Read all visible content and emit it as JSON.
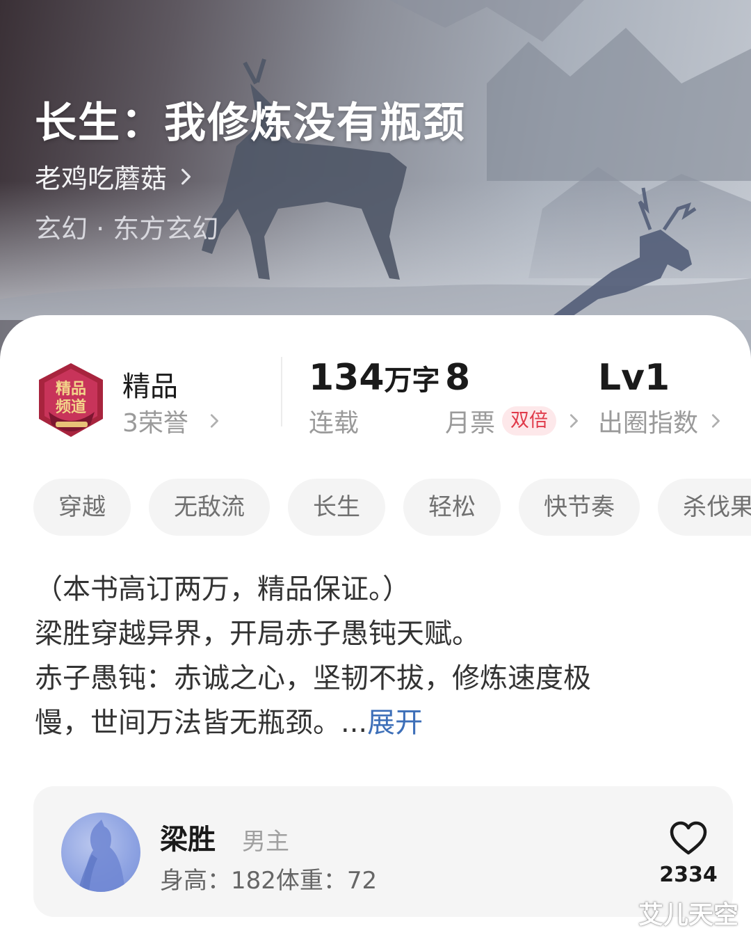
{
  "book": {
    "title": "长生：我修炼没有瓶颈",
    "author": "老鸡吃蘑菇",
    "genre": "玄幻 · 东方玄幻"
  },
  "stats": {
    "quality_title": "精品",
    "honors": "3荣誉",
    "word_count": "134",
    "word_unit": "万字",
    "status": "连载",
    "monthly_tickets": "8",
    "monthly_tickets_label": "月票",
    "double_tag": "双倍",
    "level": "Lv1",
    "level_label": "出圈指数"
  },
  "tags": [
    "穿越",
    "无敌流",
    "长生",
    "轻松",
    "快节奏",
    "杀伐果"
  ],
  "description": {
    "lines": [
      "（本书高订两万，精品保证。）",
      "梁胜穿越异界，开局赤子愚钝天赋。",
      "赤子愚钝：赤诚之心，坚韧不拔，修炼速度极",
      "慢，世间万法皆无瓶颈。..."
    ],
    "expand_label": "展开"
  },
  "character": {
    "name": "梁胜",
    "role": "男主",
    "info": "身高：182体重：72",
    "likes": "2334"
  },
  "watermark": "艾儿天空",
  "colors": {
    "accent_link": "#3d6fb8",
    "double_tag_text": "#e03a4a",
    "double_tag_bg": "#fde8ea",
    "badge": "#a8243e"
  },
  "icons": {
    "author_chevron": "chevron-right-icon",
    "like": "heart-outline-icon",
    "badge": "quality-channel-badge-icon"
  }
}
